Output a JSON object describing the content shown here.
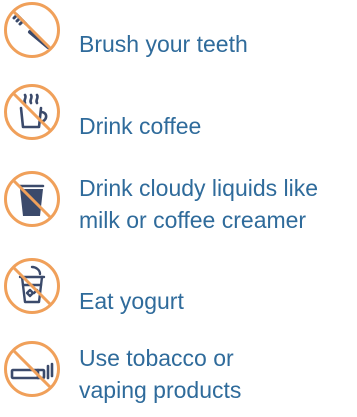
{
  "colors": {
    "prohibition": "#f0a05a",
    "icon": "#3b4a6b",
    "text": "#2f6b9b"
  },
  "items": [
    {
      "icon": "toothbrush-icon",
      "lines": [
        "Brush your teeth"
      ]
    },
    {
      "icon": "coffee-cup-icon",
      "lines": [
        "Drink coffee"
      ]
    },
    {
      "icon": "glass-icon",
      "lines": [
        "Drink cloudy liquids like",
        "milk or coffee creamer"
      ]
    },
    {
      "icon": "yogurt-cup-icon",
      "lines": [
        "Eat yogurt"
      ]
    },
    {
      "icon": "cigarette-icon",
      "lines": [
        "Use tobacco or",
        "vaping products"
      ]
    }
  ]
}
